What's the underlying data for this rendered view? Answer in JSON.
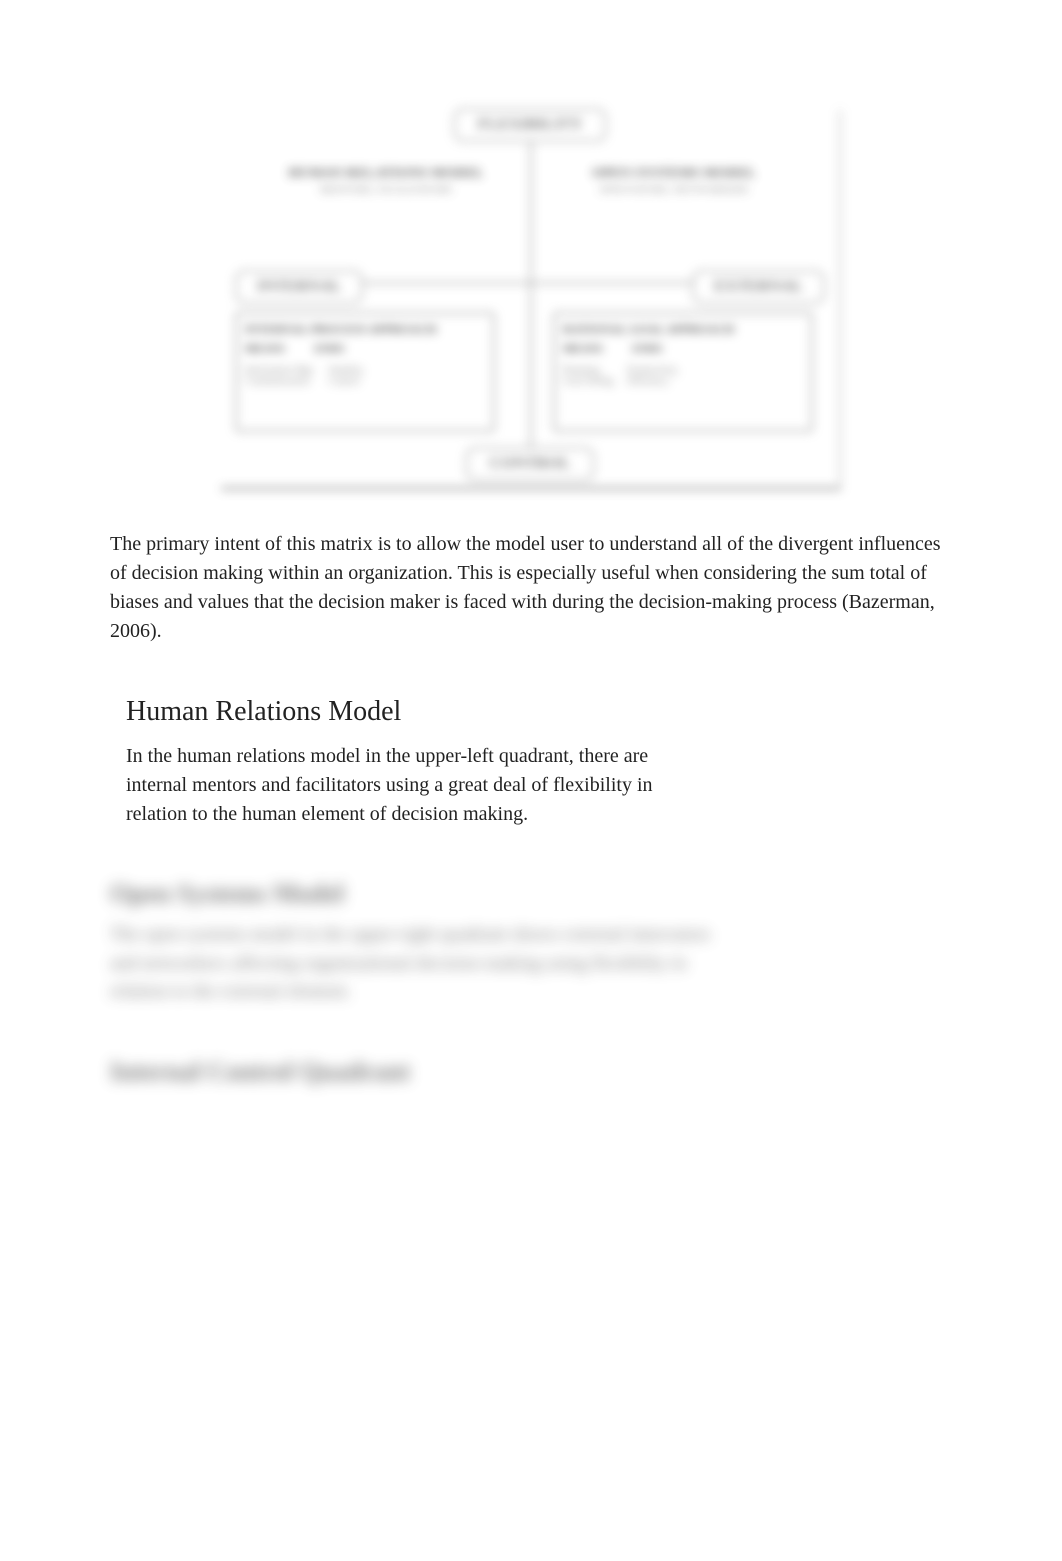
{
  "diagram": {
    "axis_top": "FLEXIBILITY",
    "axis_bottom": "CONTROL",
    "axis_left": "INTERNAL",
    "axis_right": "EXTERNAL",
    "top_left": {
      "title": "HUMAN RELATIONS MODEL",
      "subtitle": "MENTORS, FACILITATORS"
    },
    "top_right": {
      "title": "OPEN SYSTEMS MODEL",
      "subtitle": "INNOVATORS, NETWORKERS"
    },
    "bottom_left": {
      "title": "INTERNAL PROCESS APPROACH",
      "col1": "MEANS",
      "col2": "ENDS",
      "line1a": "Information Mgt,",
      "line1b": "Communication",
      "line2a": "Stability,",
      "line2b": "Control"
    },
    "bottom_right": {
      "title": "RATIONAL GOAL APPROACH",
      "col1": "MEANS",
      "col2": "ENDS",
      "line1a": "Planning,",
      "line1b": "Goal Setting",
      "line2a": "Productivity,",
      "line2b": "Efficiency"
    }
  },
  "body": {
    "p1": "The primary intent of this matrix is to allow the model user to understand all of the divergent influences of decision making within an organization. This is especially useful when considering the sum total of biases and values that the decision maker is faced with during the decision-making process (Bazerman, 2006)."
  },
  "sections": {
    "hrm": {
      "title": "Human Relations Model",
      "body": "In the human relations model in the upper-left quadrant, there are internal mentors and facilitators using a great deal of flexibility in relation to the human element of decision making."
    },
    "osm": {
      "title": "Open Systems Model",
      "body": "The open systems model in the upper-right quadrant shows external innovators and networkers affecting organizational decision making using flexibility in relation to the external element."
    },
    "icq": {
      "title": "Internal Control Quadrant"
    }
  }
}
